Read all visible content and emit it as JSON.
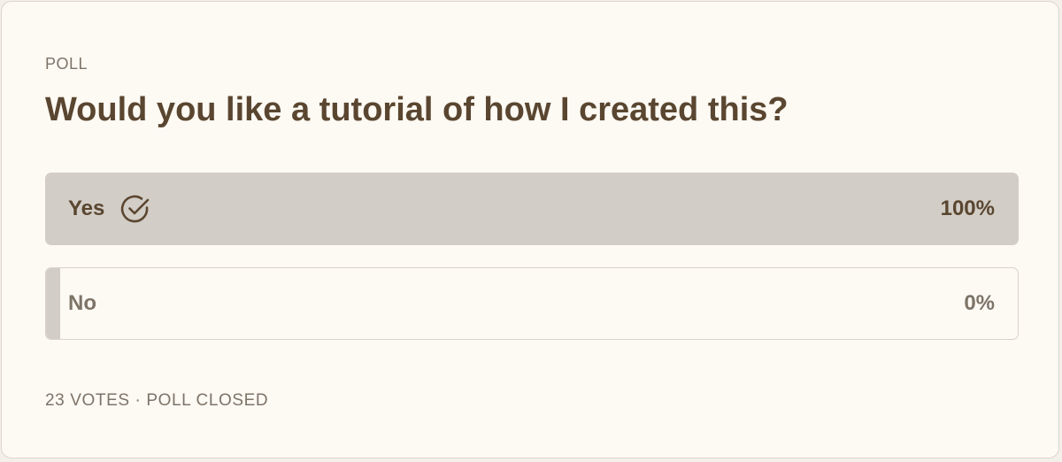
{
  "poll": {
    "eyebrow": "POLL",
    "question": "Would you like a tutorial of how I created this?",
    "options": [
      {
        "label": "Yes",
        "percent": "100%",
        "share": 1.0,
        "selected": true,
        "icon": "check-circle-icon"
      },
      {
        "label": "No",
        "percent": "0%",
        "share": 0.0,
        "selected": false
      }
    ],
    "votes": "23 VOTES",
    "separator": "·",
    "status": "POLL CLOSED"
  },
  "colors": {
    "card_background": "#fdf9f3",
    "bar_fill": "#d2cdc6",
    "heading_text": "#5a4630",
    "muted_text": "#7d7468"
  }
}
